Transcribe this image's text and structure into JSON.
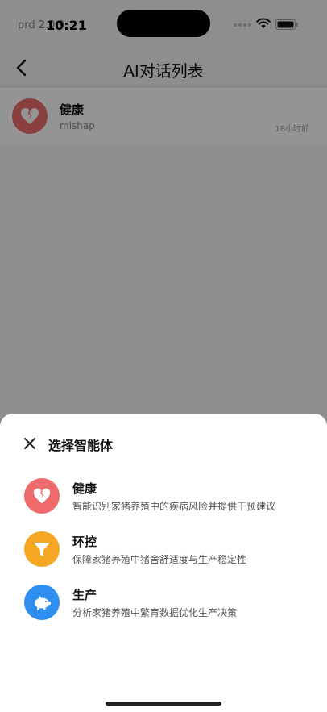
{
  "status": {
    "env_label": "prd 2.0.9",
    "time": "10:21"
  },
  "nav": {
    "title": "AI对话列表"
  },
  "conversations": [
    {
      "title": "健康",
      "subtitle": "mishap",
      "time": "18小时前",
      "icon": "broken-heart-icon",
      "color": "#ee6b6b"
    }
  ],
  "sheet": {
    "title": "选择智能体",
    "agents": [
      {
        "name": "健康",
        "desc": "智能识别家猪养殖中的疾病风险并提供干预建议",
        "icon": "broken-heart-icon",
        "color": "#ee6b6b"
      },
      {
        "name": "环控",
        "desc": "保障家猪养殖中猪舍舒适度与生产稳定性",
        "icon": "funnel-icon",
        "color": "#f5a623"
      },
      {
        "name": "生产",
        "desc": "分析家猪养殖中繁育数据优化生产决策",
        "icon": "pig-icon",
        "color": "#2f8ff0"
      }
    ]
  }
}
